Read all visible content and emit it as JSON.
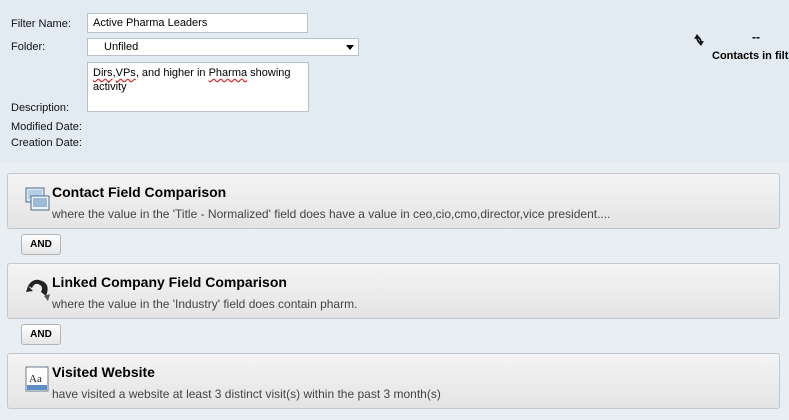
{
  "filter": {
    "name_label": "Filter Name:",
    "name_value": "Active Pharma Leaders",
    "folder_label": "Folder:",
    "folder_value": "Unfiled",
    "description_label": "Description:",
    "description_parts": [
      "Dirs",
      ",",
      "VPs",
      ", and higher in ",
      "Pharma",
      " showing activity"
    ],
    "modified_label": "Modified Date:",
    "creation_label": "Creation Date:"
  },
  "contacts": {
    "count": "--",
    "label": "Contacts in filt"
  },
  "criteria": [
    {
      "title": "Contact Field Comparison",
      "description": "where the value in the 'Title - Normalized' field does have a value in ceo,cio,cmo,director,vice president....",
      "icon": "contact-field-icon"
    },
    {
      "title": "Linked Company Field Comparison",
      "description": "where the value in the 'Industry' field does contain pharm.",
      "icon": "linked-company-icon"
    },
    {
      "title": "Visited Website",
      "description": "have visited a website at least 3 distinct visit(s) within the past 3 month(s)",
      "icon": "visited-website-icon"
    }
  ],
  "operators": [
    "AND",
    "AND"
  ]
}
